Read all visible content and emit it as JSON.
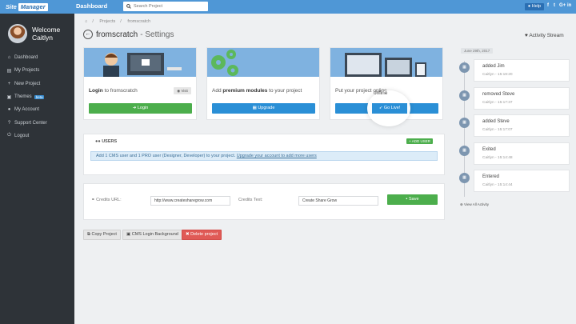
{
  "app": {
    "logo_site": "Site",
    "logo_manager": "Manager",
    "dashboard": "Dashboard"
  },
  "search": {
    "placeholder": "Search Project"
  },
  "topbar": {
    "help": "Help",
    "social": [
      "f",
      "t",
      "G+",
      "in"
    ]
  },
  "user": {
    "welcome": "Welcome",
    "name": "Caitlyn"
  },
  "sidebar": {
    "items": [
      {
        "label": "Dashboard",
        "icon": "home-icon"
      },
      {
        "label": "My Projects",
        "icon": "folder-icon"
      },
      {
        "label": "New Project",
        "icon": "plus-icon"
      },
      {
        "label": "Themes",
        "icon": "picture-icon",
        "badge": "beta"
      },
      {
        "label": "My Account",
        "icon": "user-icon"
      },
      {
        "label": "Support Center",
        "icon": "question-icon"
      },
      {
        "label": "Logout",
        "icon": "power-icon"
      }
    ]
  },
  "breadcrumb": {
    "projects": "Projects",
    "current": "fromscratch"
  },
  "page": {
    "title": "fromscratch",
    "subtitle": "- Settings"
  },
  "stream": {
    "title": "Activity Stream",
    "date": "June 29th, 2017",
    "view_all": "View All Activity",
    "items": [
      {
        "title": "added Jim",
        "meta": "Caitlyn - 15:19:20"
      },
      {
        "title": "removed Steve",
        "meta": "Caitlyn - 15:17:37"
      },
      {
        "title": "added Steve",
        "meta": "Caitlyn - 15:17:07"
      },
      {
        "title": "Exited",
        "meta": "Caitlyn - 15:14:48"
      },
      {
        "title": "Entered",
        "meta": "Caitlyn - 15:14:44"
      }
    ]
  },
  "cards": {
    "login": {
      "pre": "Login",
      "post": " to fromscratch",
      "visit": "Visit",
      "button": "Login"
    },
    "modules": {
      "pre": "Add ",
      "bold": "premium modules",
      "post": " to your project",
      "button": "Upgrade"
    },
    "golive": {
      "text": "Put your project online",
      "button": "Go Live!"
    }
  },
  "users": {
    "heading": "USERS",
    "add_button": "ADD USER",
    "info": "Add 1 CMS user and 1 PRO user (Designer, Developer) to your project.",
    "info_link": "Upgrade your account to add more users"
  },
  "credits": {
    "url_label": "Credits URL:",
    "url_value": "http://www.createsharegrow.com",
    "text_label": "Credits Text:",
    "text_value": "Create Share Grow",
    "save": "Save"
  },
  "actions": {
    "copy": "Copy Project",
    "cms_bg": "CMS Login Background",
    "delete": "Delete project"
  },
  "colors": {
    "topbar": "#4f97d6",
    "sidebar": "#2e3338",
    "green": "#4cae4c",
    "blue": "#2a8fd6",
    "red": "#e05a56"
  }
}
